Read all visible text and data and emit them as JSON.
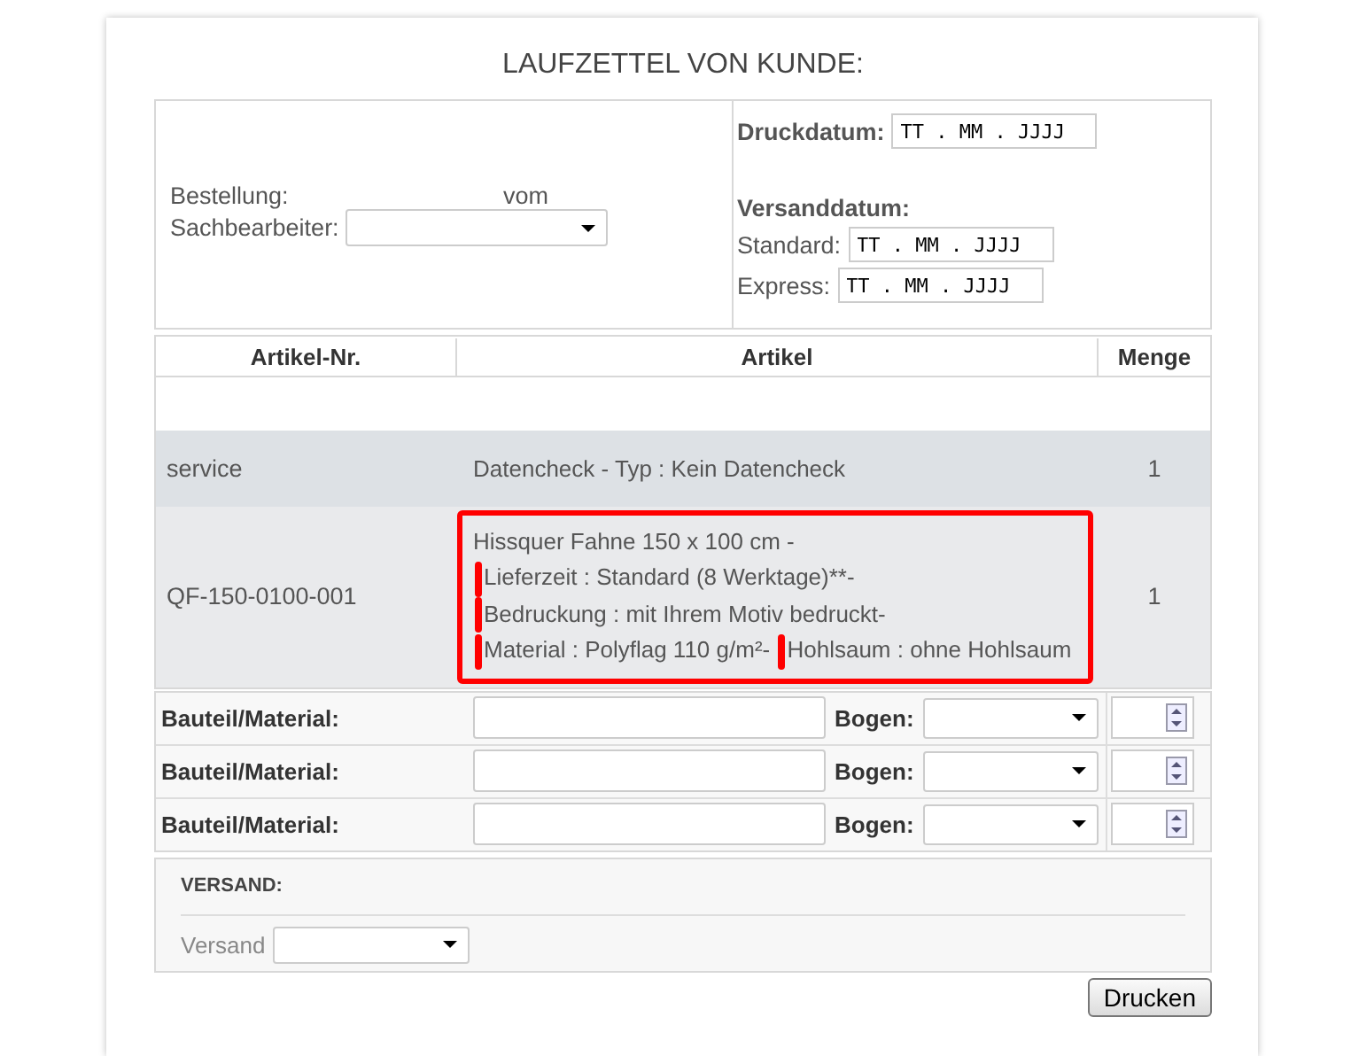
{
  "title": "LAUFZETTEL VON KUNDE:",
  "order": {
    "label": "Bestellung:",
    "date_label": "vom",
    "clerk_label": "Sachbearbeiter:"
  },
  "dates": {
    "print_label": "Druckdatum:",
    "print_value": "TT . MM . JJJJ",
    "shipping_label": "Versanddatum:",
    "shipping": [
      {
        "label": "Standard:",
        "value": "TT . MM . JJJJ"
      },
      {
        "label": "Express:",
        "value": "TT . MM . JJJJ"
      }
    ]
  },
  "table": {
    "columns": [
      "Artikel-Nr.",
      "Artikel",
      "Menge"
    ],
    "rows": [
      {
        "kind": "blank"
      },
      {
        "kind": "item",
        "article_no": "service",
        "highlighted": false,
        "segments": [
          {
            "text": "Datencheck - Typ : Kein Datencheck",
            "marked": false
          }
        ],
        "quantity": "1"
      },
      {
        "kind": "item",
        "article_no": "QF-150-0100-001",
        "highlighted": true,
        "segments": [
          {
            "text": "Hissquer Fahne 150 x 100 cm -",
            "marked": false
          },
          {
            "text": "Lieferzeit : Standard (8 Werktage)**-",
            "marked": true
          },
          {
            "text": "Bedruckung : mit Ihrem Motiv bedruckt-",
            "marked": true
          },
          {
            "text": "Material : Polyflag 110 g/m²-",
            "marked": true
          },
          {
            "text": "Hohlsaum : ohne Hohlsaum",
            "marked": true
          }
        ],
        "quantity": "1"
      }
    ]
  },
  "materials": [
    {
      "label": "Bauteil/Material:",
      "sheet_label": "Bogen:"
    },
    {
      "label": "Bauteil/Material:",
      "sheet_label": "Bogen:"
    },
    {
      "label": "Bauteil/Material:",
      "sheet_label": "Bogen:"
    }
  ],
  "shipping": {
    "heading": "VERSAND:",
    "label": "Versand"
  },
  "print_button": "Drucken"
}
